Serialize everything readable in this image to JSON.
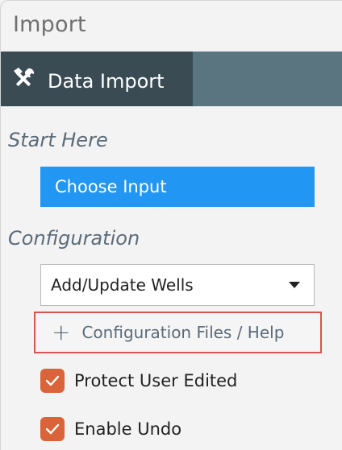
{
  "window": {
    "title": "Import"
  },
  "tab": {
    "label": "Data Import",
    "icon": "tools-icon"
  },
  "sections": {
    "start_heading": "Start Here",
    "config_heading": "Configuration"
  },
  "start": {
    "button_label": "Choose Input"
  },
  "config": {
    "select_value": "Add/Update Wells",
    "link_icon": "plus-icon",
    "link_label": "Configuration Files / Help"
  },
  "options": {
    "protect_label": "Protect User Edited",
    "protect_checked": true,
    "undo_label": "Enable Undo",
    "undo_checked": true
  },
  "colors": {
    "tab_active": "#3a4b54",
    "tab_strip": "#5a7480",
    "primary_button": "#2196f3",
    "checkbox": "#d9643a",
    "highlight_border": "#d9534f",
    "heading_text": "#5b6b78"
  }
}
